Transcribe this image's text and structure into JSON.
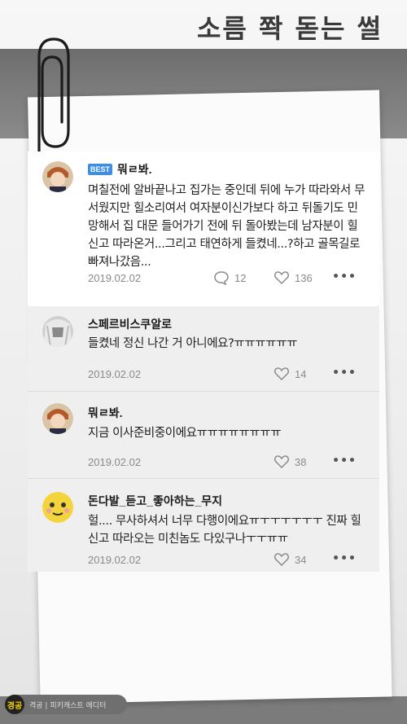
{
  "header": {
    "title": "소름 쫙 돋는 썰"
  },
  "best_comment": {
    "badge": "BEST",
    "author": "뭐ㄹ봐.",
    "text": "며칠전에 알바끝나고 집가는 중인데 뒤에 누가 따라와서 무서웠지만 힐소리여서 여자분이신가보다 하고 뒤돌기도 민망해서 집 대문 들어가기 전에 뒤 돌아봤는데 남자분이 힐신고 따라온거...그리고 태연하게 들켰네...?하고 골목길로 빠져나갔음...",
    "date": "2019.02.02",
    "reply_count": "12",
    "like_count": "136"
  },
  "replies": [
    {
      "author": "스페르비스쿠알로",
      "text": "들켰네 정신 나간 거 아니에요?ㅠㅠㅠㅠㅠㅠ",
      "date": "2019.02.02",
      "like_count": "14"
    },
    {
      "author": "뭐ㄹ봐.",
      "text": "지금 이사준비중이에요ㅠㅠㅠㅠㅠㅠㅠㅠ",
      "date": "2019.02.02",
      "like_count": "38"
    },
    {
      "author": "돈다발_듣고_좋아하는_무지",
      "text": "헐.... 무사하셔서 너무 다행이에요ㅠㅜㅜㅜㅜㅜㅜ 진짜 힐신고 따라오는 미친놈도 다있구나ㅜㅜㅠㅠ",
      "date": "2019.02.02",
      "like_count": "34"
    }
  ],
  "footer": {
    "logo_text": "경공",
    "caption": "격공 | 피키캐스트 에디터"
  },
  "colors": {
    "best_badge": "#3d8fe6",
    "reply_bg": "#efefef",
    "meta_text": "#8a8a8a"
  }
}
